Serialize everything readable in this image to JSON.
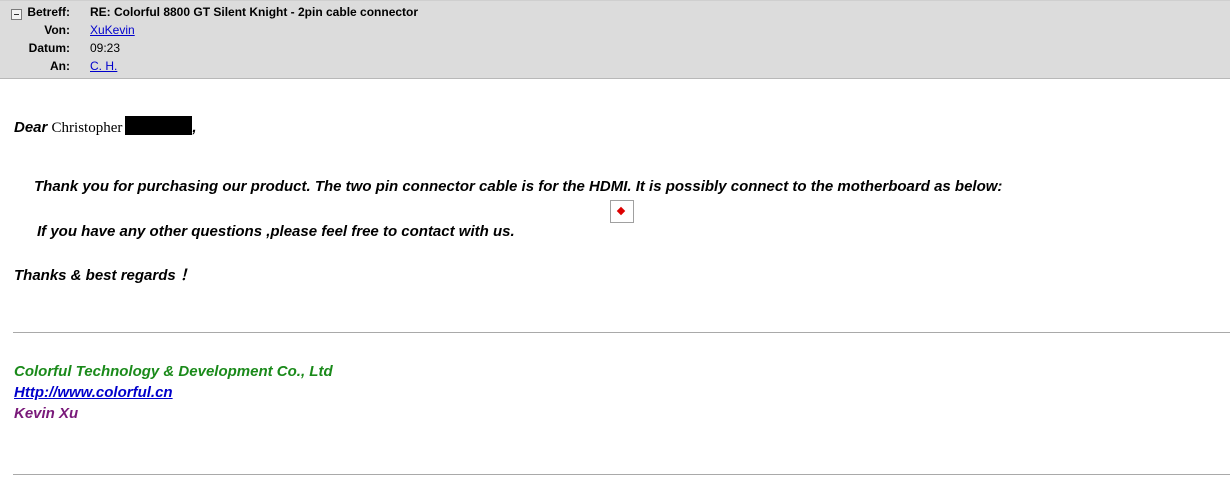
{
  "header": {
    "subject_label": "Betreff:",
    "subject": "RE: Colorful 8800 GT Silent Knight - 2pin cable connector",
    "from_label": "Von:",
    "from": "XuKevin",
    "date_label": "Datum:",
    "date": "09:23",
    "to_label": "An:",
    "to": "C. H."
  },
  "message": {
    "salutation_word": "Dear",
    "salutation_name": "Christopher",
    "salutation_comma": ",",
    "paragraph1": "Thank you for purchasing our product. The two pin connector cable is for the HDMI. It is possibly connect to the motherboard as below:",
    "paragraph2": "If you have any other questions ,please feel free to contact with us.",
    "closing": "Thanks & best regards ！"
  },
  "signature": {
    "company": "Colorful Technology & Development Co., Ltd",
    "website": "Http://www.colorful.cn",
    "name": "Kevin Xu"
  },
  "colors": {
    "company": "#1a8a1a",
    "website": "#0000cc",
    "name": "#7a1a7a"
  }
}
